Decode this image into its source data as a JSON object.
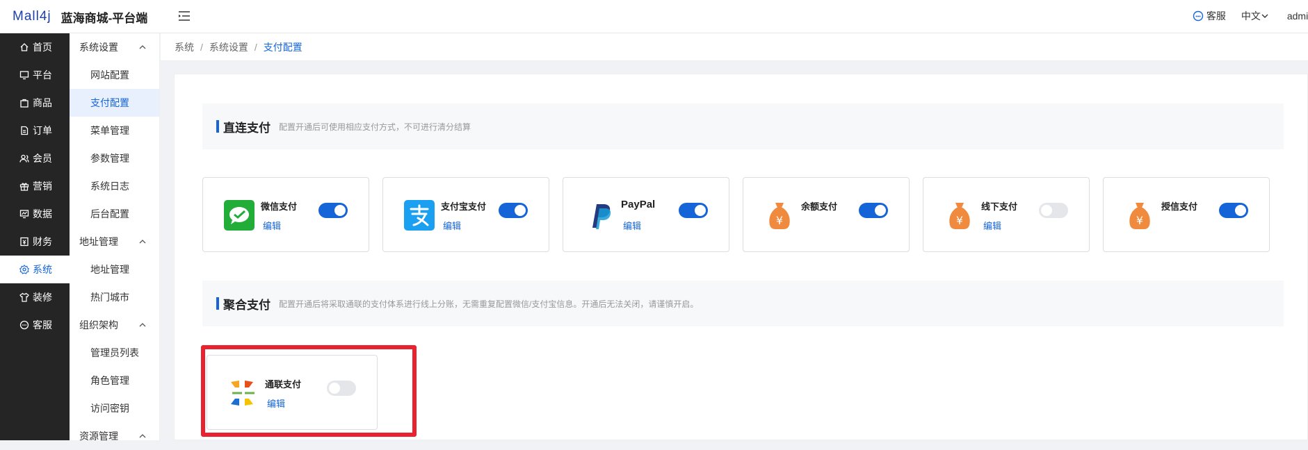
{
  "header": {
    "logo_mark": "Mall4j",
    "title": "蓝海商城-平台端",
    "service_label": "客服",
    "lang_label": "中文",
    "user_label": "admin"
  },
  "nav": [
    {
      "label": "首页",
      "icon": "home-icon"
    },
    {
      "label": "平台",
      "icon": "monitor-icon"
    },
    {
      "label": "商品",
      "icon": "bag-icon"
    },
    {
      "label": "订单",
      "icon": "order-icon"
    },
    {
      "label": "会员",
      "icon": "members-icon"
    },
    {
      "label": "营销",
      "icon": "gift-icon"
    },
    {
      "label": "数据",
      "icon": "chart-icon"
    },
    {
      "label": "财务",
      "icon": "wallet-icon"
    },
    {
      "label": "系统",
      "icon": "gear-icon"
    },
    {
      "label": "装修",
      "icon": "shirt-icon"
    },
    {
      "label": "客服",
      "icon": "chat-icon"
    }
  ],
  "submenu": {
    "g1": "系统设置",
    "g1_items": [
      "网站配置",
      "支付配置",
      "菜单管理",
      "参数管理",
      "系统日志",
      "后台配置"
    ],
    "g2": "地址管理",
    "g2_items": [
      "地址管理",
      "热门城市"
    ],
    "g3": "组织架构",
    "g3_items": [
      "管理员列表",
      "角色管理",
      "访问密钥"
    ],
    "g4": "资源管理"
  },
  "breadcrumb": {
    "c1": "系统",
    "c2": "系统设置",
    "c3": "支付配置",
    "sep": "/"
  },
  "direct": {
    "title": "直连支付",
    "desc": "配置开通后可使用相应支付方式，不可进行清分结算",
    "cards": [
      {
        "name": "微信支付",
        "edit": "编辑",
        "enabled": true,
        "icon": "wechat-pay-icon"
      },
      {
        "name": "支付宝支付",
        "edit": "编辑",
        "enabled": true,
        "icon": "alipay-icon"
      },
      {
        "name": "PayPal",
        "edit": "编辑",
        "enabled": true,
        "icon": "paypal-icon"
      },
      {
        "name": "余额支付",
        "enabled": true,
        "icon": "money-bag-icon"
      },
      {
        "name": "线下支付",
        "edit": "编辑",
        "enabled": false,
        "icon": "money-bag-icon"
      },
      {
        "name": "授信支付",
        "enabled": true,
        "icon": "money-bag-icon"
      }
    ]
  },
  "aggregate": {
    "title": "聚合支付",
    "desc": "配置开通后将采取通联的支付体系进行线上分账，无需重复配置微信/支付宝信息。开通后无法关闭，请谨慎开启。",
    "cards": [
      {
        "name": "通联支付",
        "edit": "编辑",
        "enabled": false,
        "icon": "allinpay-icon"
      }
    ]
  },
  "colors": {
    "accent": "#1565d8",
    "nav_bg": "#252525",
    "highlight": "#e8222e"
  }
}
